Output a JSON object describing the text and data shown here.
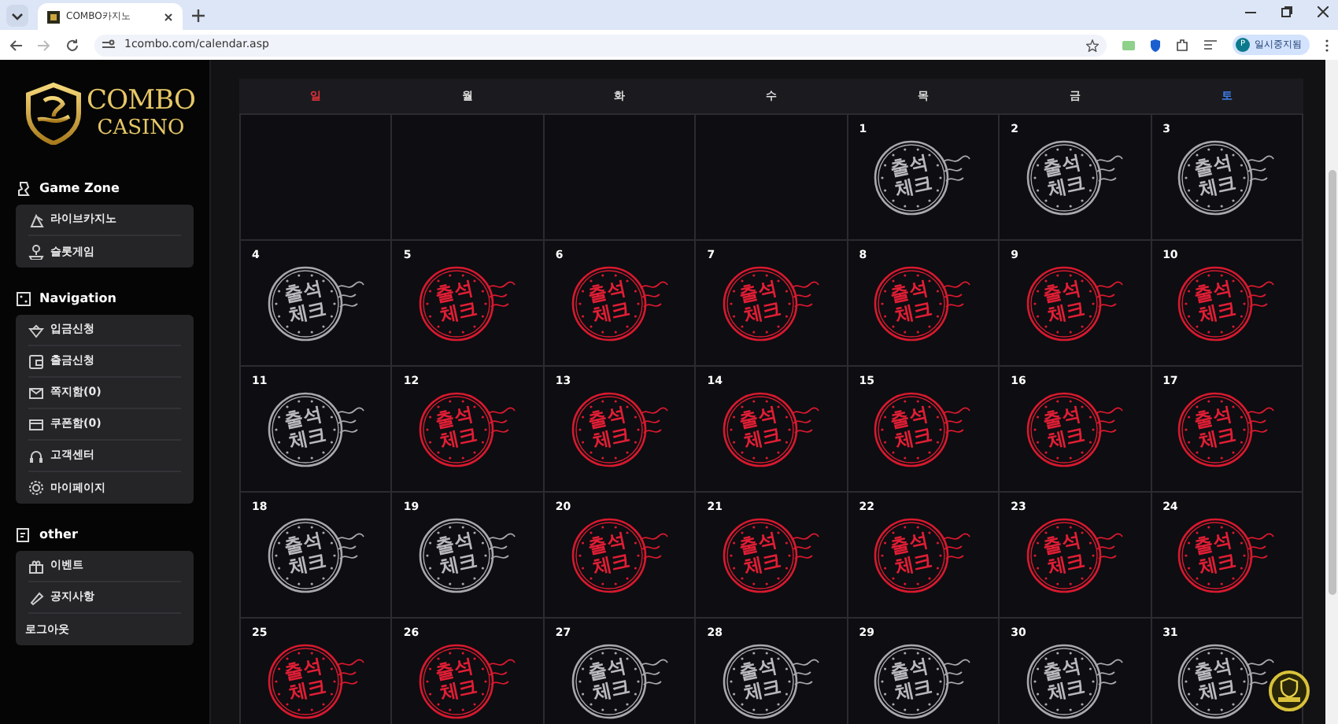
{
  "browser": {
    "tab_title": "COMBO카지노",
    "url": "1combo.com/calendar.asp",
    "profile": "일시중지됨",
    "profile_initial": "P"
  },
  "logo": {
    "top": "COMBO",
    "bottom": "CASINO"
  },
  "sidebar": [
    {
      "heading": "Game Zone",
      "items": [
        {
          "label": "라이브카지노",
          "kind": "icon"
        },
        {
          "label": "슬롯게임",
          "kind": "icon"
        }
      ]
    },
    {
      "heading": "Navigation",
      "items": [
        {
          "label": "입금신청",
          "kind": "icon"
        },
        {
          "label": "출금신청",
          "kind": "icon"
        },
        {
          "label": "쪽지함(0)",
          "kind": "icon"
        },
        {
          "label": "쿠폰함(0)",
          "kind": "icon"
        },
        {
          "label": "고객센터",
          "kind": "icon"
        },
        {
          "label": "마이페이지",
          "kind": "icon"
        }
      ]
    },
    {
      "heading": "other",
      "items": [
        {
          "label": "이벤트",
          "kind": "icon"
        },
        {
          "label": "공지사항",
          "kind": "icon"
        },
        {
          "label": "로그아웃",
          "kind": "plain"
        }
      ]
    }
  ],
  "calendar": {
    "weekdays": [
      {
        "label": "일",
        "kind": "sun"
      },
      {
        "label": "월",
        "kind": "day"
      },
      {
        "label": "화",
        "kind": "day"
      },
      {
        "label": "수",
        "kind": "day"
      },
      {
        "label": "목",
        "kind": "day"
      },
      {
        "label": "금",
        "kind": "day"
      },
      {
        "label": "토",
        "kind": "sat"
      }
    ],
    "weeks": [
      [
        {
          "kind": "empty"
        },
        {
          "kind": "empty"
        },
        {
          "kind": "empty"
        },
        {
          "kind": "empty"
        },
        {
          "day": "1",
          "stamp_top": "출석",
          "stamp_bottom": "체크",
          "attended": false
        },
        {
          "day": "2",
          "stamp_top": "출석",
          "stamp_bottom": "체크",
          "attended": false
        },
        {
          "day": "3",
          "stamp_top": "출석",
          "stamp_bottom": "체크",
          "attended": false
        }
      ],
      [
        {
          "day": "4",
          "stamp_top": "출석",
          "stamp_bottom": "체크",
          "attended": false
        },
        {
          "day": "5",
          "stamp_top": "출석",
          "stamp_bottom": "체크",
          "attended": true
        },
        {
          "day": "6",
          "stamp_top": "출석",
          "stamp_bottom": "체크",
          "attended": true
        },
        {
          "day": "7",
          "stamp_top": "출석",
          "stamp_bottom": "체크",
          "attended": true
        },
        {
          "day": "8",
          "stamp_top": "출석",
          "stamp_bottom": "체크",
          "attended": true
        },
        {
          "day": "9",
          "stamp_top": "출석",
          "stamp_bottom": "체크",
          "attended": true
        },
        {
          "day": "10",
          "stamp_top": "출석",
          "stamp_bottom": "체크",
          "attended": true
        }
      ],
      [
        {
          "day": "11",
          "stamp_top": "출석",
          "stamp_bottom": "체크",
          "attended": false
        },
        {
          "day": "12",
          "stamp_top": "출석",
          "stamp_bottom": "체크",
          "attended": true
        },
        {
          "day": "13",
          "stamp_top": "출석",
          "stamp_bottom": "체크",
          "attended": true
        },
        {
          "day": "14",
          "stamp_top": "출석",
          "stamp_bottom": "체크",
          "attended": true
        },
        {
          "day": "15",
          "stamp_top": "출석",
          "stamp_bottom": "체크",
          "attended": true
        },
        {
          "day": "16",
          "stamp_top": "출석",
          "stamp_bottom": "체크",
          "attended": true
        },
        {
          "day": "17",
          "stamp_top": "출석",
          "stamp_bottom": "체크",
          "attended": true
        }
      ],
      [
        {
          "day": "18",
          "stamp_top": "출석",
          "stamp_bottom": "체크",
          "attended": false
        },
        {
          "day": "19",
          "stamp_top": "출석",
          "stamp_bottom": "체크",
          "attended": false
        },
        {
          "day": "20",
          "stamp_top": "출석",
          "stamp_bottom": "체크",
          "attended": true
        },
        {
          "day": "21",
          "stamp_top": "출석",
          "stamp_bottom": "체크",
          "attended": true
        },
        {
          "day": "22",
          "stamp_top": "출석",
          "stamp_bottom": "체크",
          "attended": true
        },
        {
          "day": "23",
          "stamp_top": "출석",
          "stamp_bottom": "체크",
          "attended": true
        },
        {
          "day": "24",
          "stamp_top": "출석",
          "stamp_bottom": "체크",
          "attended": true
        }
      ],
      [
        {
          "day": "25",
          "stamp_top": "출석",
          "stamp_bottom": "체크",
          "attended": true
        },
        {
          "day": "26",
          "stamp_top": "출석",
          "stamp_bottom": "체크",
          "attended": true
        },
        {
          "day": "27",
          "stamp_top": "출석",
          "stamp_bottom": "체크",
          "attended": false
        },
        {
          "day": "28",
          "stamp_top": "출석",
          "stamp_bottom": "체크",
          "attended": false
        },
        {
          "day": "29",
          "stamp_top": "출석",
          "stamp_bottom": "체크",
          "attended": false
        },
        {
          "day": "30",
          "stamp_top": "출석",
          "stamp_bottom": "체크",
          "attended": false
        },
        {
          "day": "31",
          "stamp_top": "출석",
          "stamp_bottom": "체크",
          "attended": false
        }
      ]
    ]
  }
}
